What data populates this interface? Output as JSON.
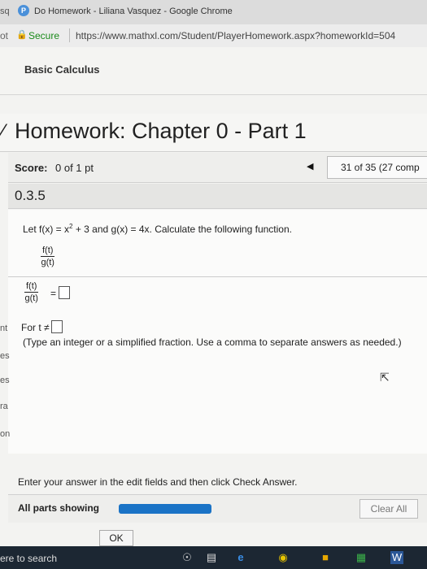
{
  "window": {
    "tab_left": "sq",
    "title": "Do Homework - Liliana Vasquez - Google Chrome",
    "addr_left": "ot",
    "secure_label": "Secure",
    "url": "https://www.mathxl.com/Student/PlayerHomework.aspx?homeworkId=504"
  },
  "course": {
    "title": "Basic Calculus"
  },
  "homework": {
    "title": "Homework: Chapter 0 - Part 1",
    "score_label": "Score:",
    "score_value": "0 of 1 pt",
    "question_nav": "31 of 35 (27 comp",
    "section": "0.3.5"
  },
  "problem": {
    "text_1": "Let f(x) = x",
    "exp": "2",
    "text_2": " + 3 and g(x) = 4x. Calculate the following function.",
    "frac_num": "f(t)",
    "frac_den": "g(t)",
    "eq": "=",
    "for_t": "For t ≠",
    "hint": "(Type an integer or a simplified fraction. Use a comma to separate answers as needed.)"
  },
  "side_fragments": [
    "nt",
    "es",
    "es",
    "ra",
    "on"
  ],
  "footer": {
    "instruction": "Enter your answer in the edit fields and then click Check Answer.",
    "parts_label": "All parts showing",
    "progress": 1.0,
    "clear_all": "Clear All",
    "ok": "OK"
  },
  "taskbar": {
    "search": "ere to search"
  },
  "colors": {
    "accent": "#1a73c6",
    "taskbar": "#1c2733"
  }
}
